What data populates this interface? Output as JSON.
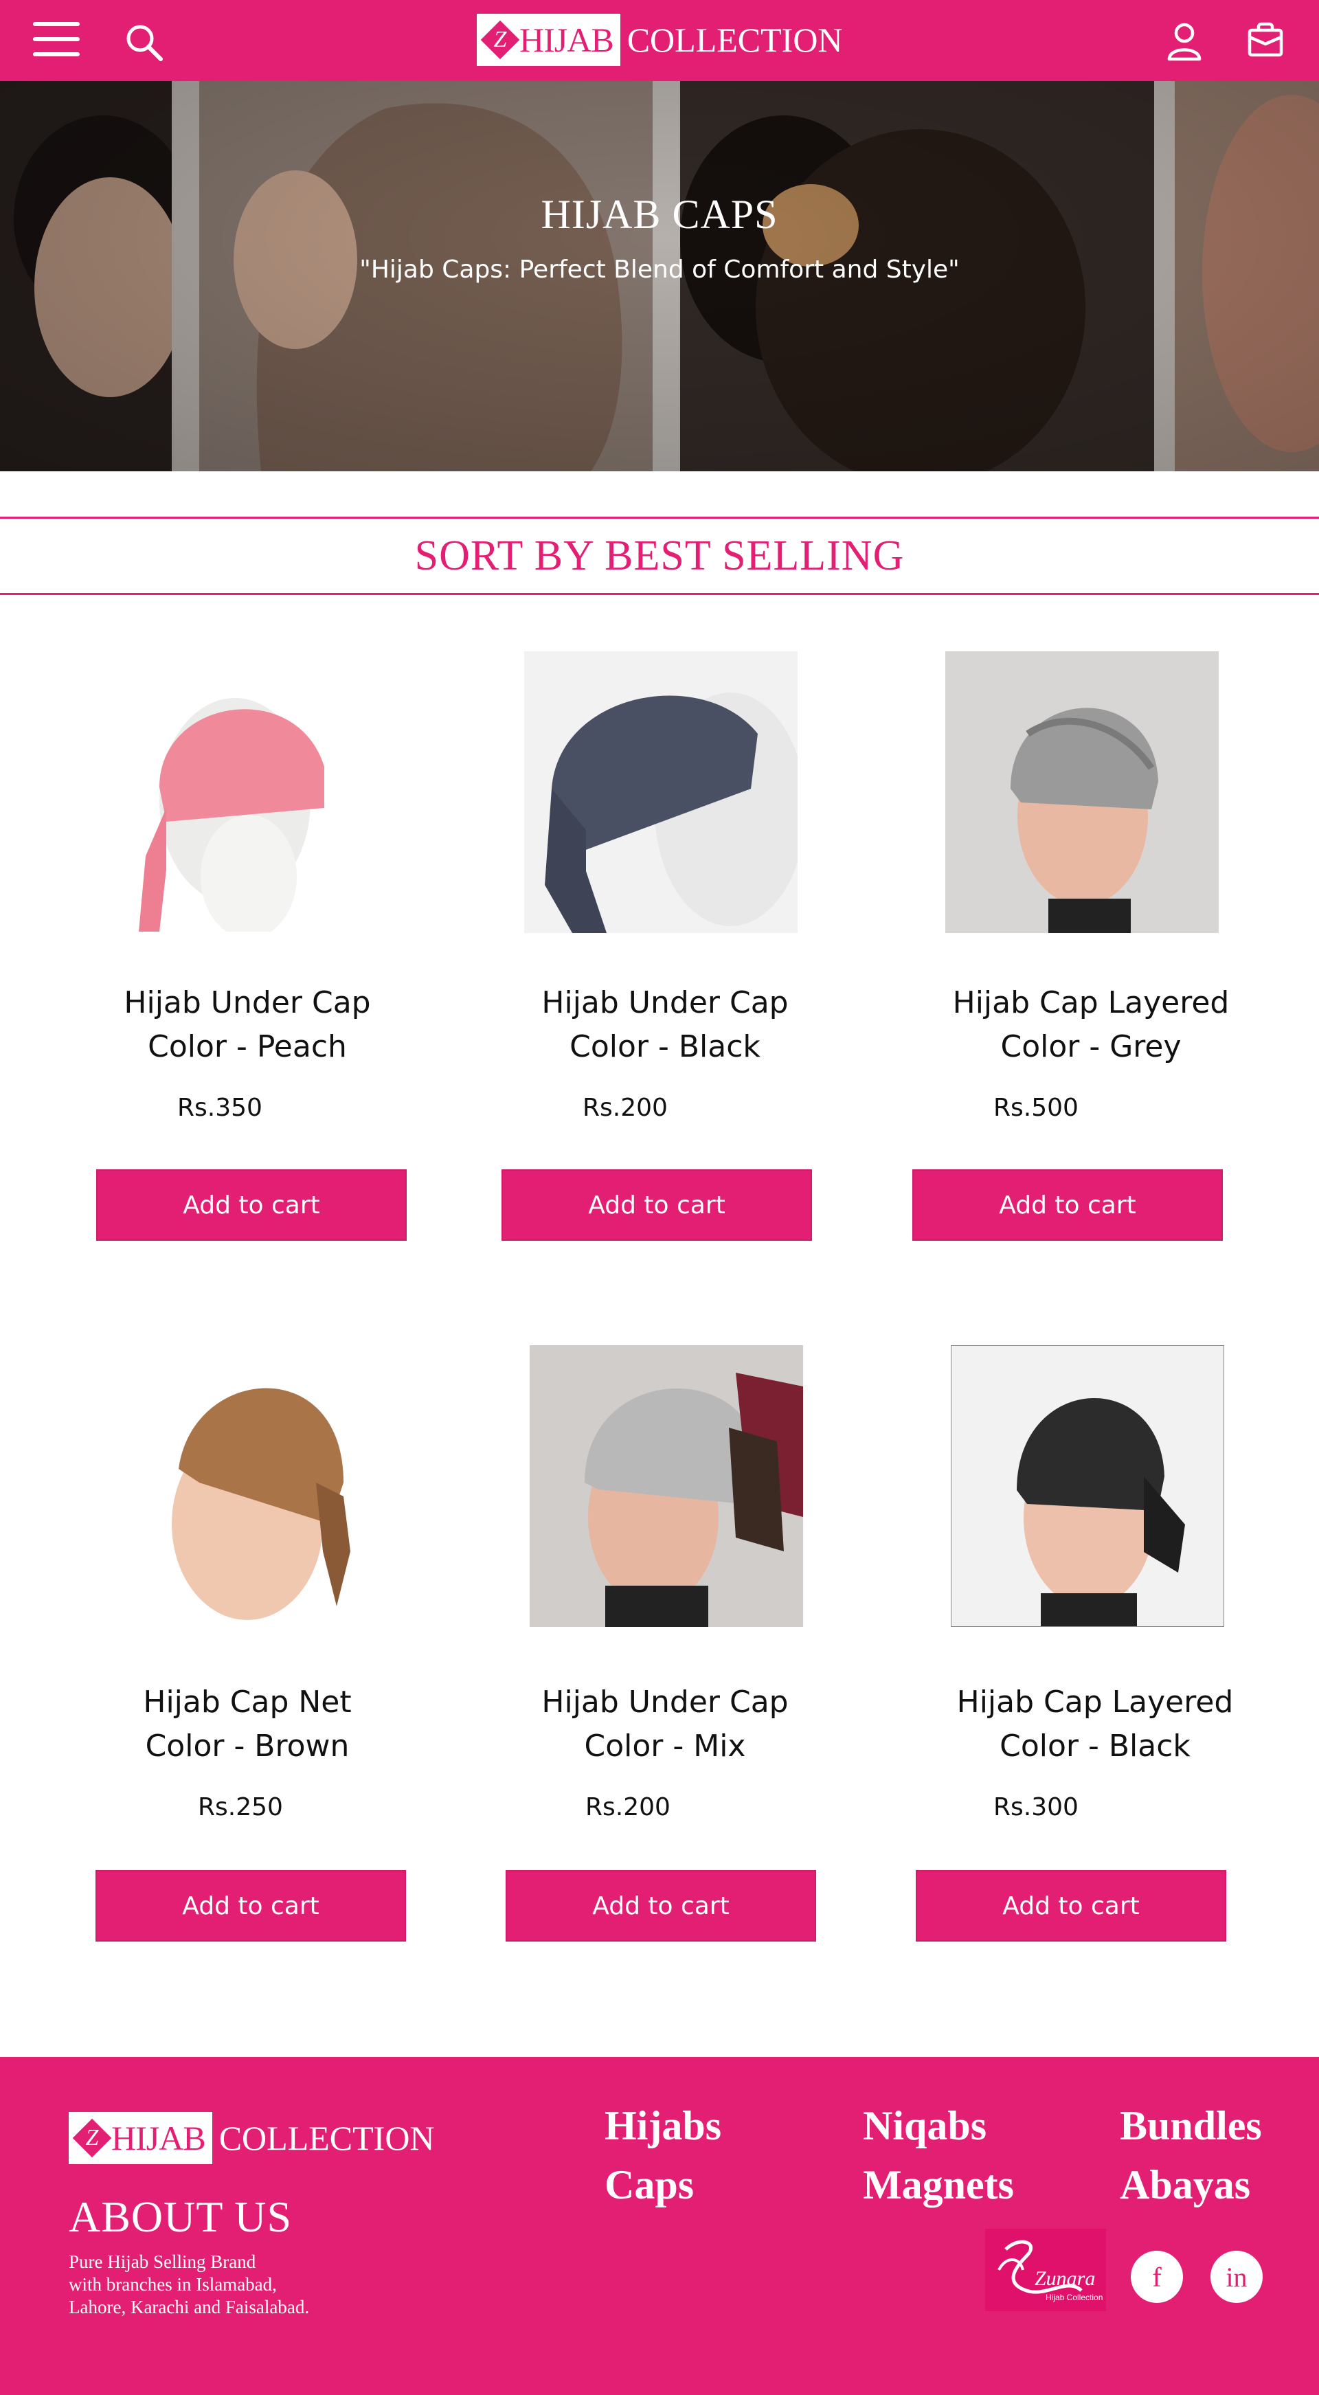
{
  "header": {
    "logo": {
      "mark": "Z",
      "word1": "HIJAB",
      "word2": "COLLECTION"
    },
    "icons": [
      "menu-icon",
      "search-icon",
      "user-icon",
      "shopping-bag-icon"
    ]
  },
  "hero": {
    "title": "HIJAB CAPS",
    "subtitle": "\"Hijab Caps: Perfect Blend of Comfort and Style\""
  },
  "sort": {
    "label": "SORT BY BEST SELLING"
  },
  "products": [
    {
      "name_line1": "Hijab Under Cap",
      "name_line2": "Color - Peach",
      "price": "Rs.350",
      "button": "Add to cart"
    },
    {
      "name_line1": "Hijab Under Cap",
      "name_line2": "Color - Black",
      "price": "Rs.200",
      "button": "Add to cart"
    },
    {
      "name_line1": "Hijab Cap Layered",
      "name_line2": "Color - Grey",
      "price": "Rs.500",
      "button": "Add to cart"
    },
    {
      "name_line1": "Hijab Cap Net",
      "name_line2": "Color - Brown",
      "price": "Rs.250",
      "button": "Add to cart"
    },
    {
      "name_line1": "Hijab Under Cap",
      "name_line2": "Color - Mix",
      "price": "Rs.200",
      "button": "Add to cart"
    },
    {
      "name_line1": "Hijab Cap Layered",
      "name_line2": "Color - Black",
      "price": "Rs.300",
      "button": "Add to cart"
    }
  ],
  "footer": {
    "logo": {
      "mark": "Z",
      "word1": "HIJAB",
      "word2": "COLLECTION"
    },
    "about_title": "ABOUT US",
    "about_text": [
      "Pure Hijab Selling Brand",
      "with branches in Islamabad,",
      "Lahore, Karachi and Faisalabad."
    ],
    "links": [
      "Hijabs",
      "Caps",
      "Niqabs",
      "Magnets",
      "Bundles",
      "Abayas"
    ],
    "partner_logo": {
      "name": "Zunara",
      "tagline": "Hijab Collection"
    },
    "social": [
      "f",
      "in"
    ]
  },
  "colors": {
    "brand": "#e31f74",
    "text": "#111111",
    "white": "#ffffff"
  }
}
